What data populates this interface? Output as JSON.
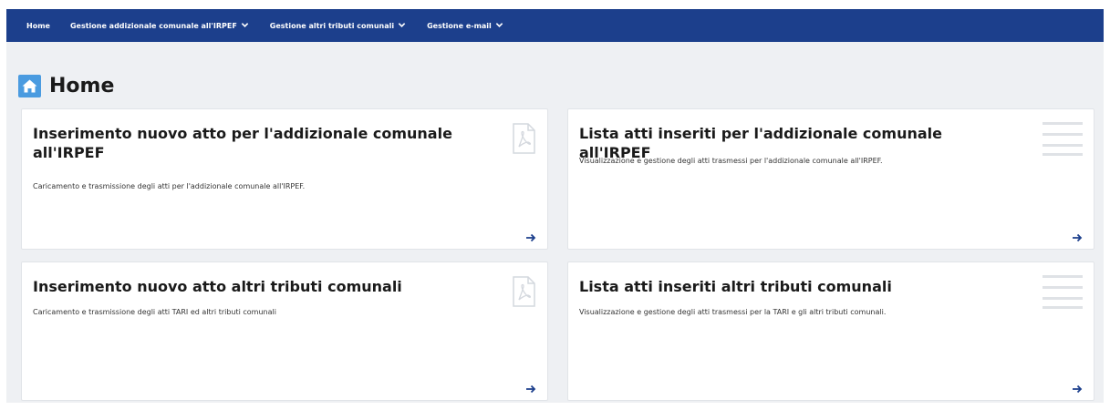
{
  "nav": {
    "items": [
      {
        "label": "Home"
      },
      {
        "label": "Gestione addizionale comunale all'IRPEF"
      },
      {
        "label": "Gestione altri tributi comunali"
      },
      {
        "label": "Gestione e-mail"
      }
    ]
  },
  "page": {
    "title": "Home"
  },
  "cards": [
    {
      "title": "Inserimento nuovo atto per l'addizionale comunale all'IRPEF",
      "description": "Caricamento e trasmissione degli atti per l'addizionale comunale all'IRPEF.",
      "icon": "pdf-document-icon"
    },
    {
      "title": "Lista atti inseriti per l'addizionale comunale all'IRPEF",
      "description": "Visualizzazione e gestione degli atti trasmessi per l'addizionale comunale all'IRPEF.",
      "icon": "list-icon"
    },
    {
      "title": "Inserimento nuovo atto altri tributi comunali",
      "description": "Caricamento e trasmissione degli atti TARI ed altri tributi comunali",
      "icon": "pdf-document-icon"
    },
    {
      "title": "Lista atti inseriti altri tributi comunali",
      "description": "Visualizzazione e gestione degli atti trasmessi per la TARI e gli altri tributi comunali.",
      "icon": "list-icon"
    }
  ],
  "colors": {
    "navbar": "#1c3f8c",
    "accent": "#1c3f8c",
    "home_icon": "#4a9be0",
    "background": "#eef0f3"
  }
}
